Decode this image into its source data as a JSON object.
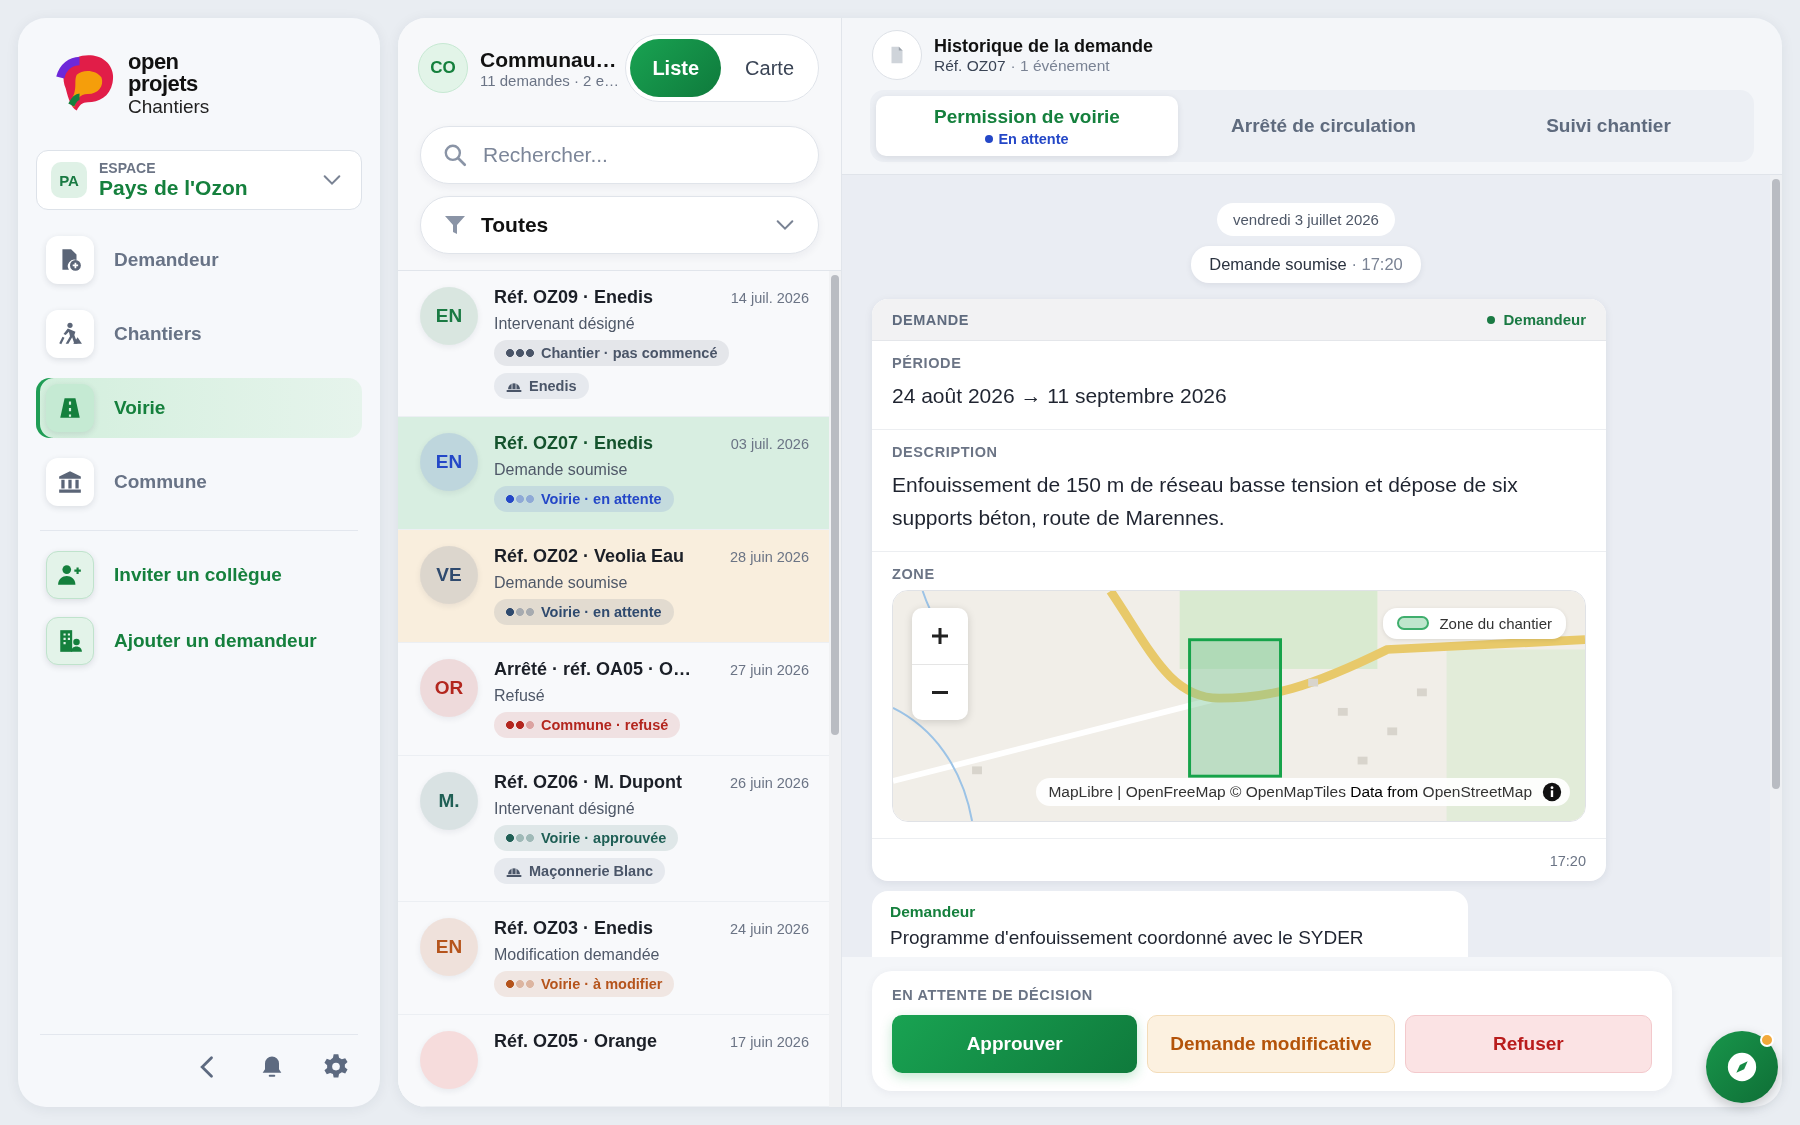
{
  "sidebar": {
    "logo": {
      "line_1": "open",
      "line_2": "projets",
      "line_3": "Chantiers"
    },
    "workspace": {
      "initials": "PA",
      "label": "ESPACE",
      "name": "Pays de l'Ozon"
    },
    "nav": [
      {
        "label": "Demandeur",
        "selected": false
      },
      {
        "label": "Chantiers",
        "selected": false
      },
      {
        "label": "Voirie",
        "selected": true
      },
      {
        "label": "Commune",
        "selected": false
      }
    ],
    "actions": [
      {
        "label": "Inviter un collègue"
      },
      {
        "label": "Ajouter un demandeur"
      }
    ]
  },
  "list_panel": {
    "avatar": "CO",
    "title": "Communau…",
    "subtitle": "11 demandes · 2 e…",
    "view_toggle": [
      {
        "label": "Liste",
        "selected": true
      },
      {
        "label": "Carte",
        "selected": false
      }
    ],
    "search": {
      "placeholder": "Rechercher..."
    },
    "filter": {
      "value": "Toutes"
    },
    "items": [
      {
        "initials": "EN",
        "color": "#1a7a43",
        "title": "Réf. OZ09 · Enedis",
        "date": "14 juil. 2026",
        "status": "Intervenant désigné",
        "selected": false,
        "hovered": false,
        "tags": [
          {
            "kind": "status",
            "label": "Chantier · pas commencé",
            "color": "#4a5568",
            "level": 1
          },
          {
            "kind": "company",
            "label": "Enedis"
          }
        ]
      },
      {
        "initials": "EN",
        "color": "#2447c7",
        "title": "Réf. OZ07 · Enedis",
        "date": "03 juil. 2026",
        "status": "Demande soumise",
        "selected": true,
        "hovered": false,
        "tags": [
          {
            "kind": "status",
            "label": "Voirie · en attente",
            "color": "#2447c7",
            "level": 0.33
          }
        ]
      },
      {
        "initials": "VE",
        "color": "#2f4a6e",
        "title": "Réf. OZ02 · Veolia Eau",
        "date": "28 juin 2026",
        "status": "Demande soumise",
        "selected": false,
        "hovered": true,
        "tags": [
          {
            "kind": "status",
            "label": "Voirie · en attente",
            "color": "#2f4a6e",
            "level": 0.33
          }
        ]
      },
      {
        "initials": "OR",
        "color": "#b3261e",
        "title": "Arrêté · réf. OA05 · O…",
        "date": "27 juin 2026",
        "status": "Refusé",
        "selected": false,
        "hovered": false,
        "tags": [
          {
            "kind": "status",
            "label": "Commune · refusé",
            "color": "#b3261e",
            "level": 0.67
          }
        ]
      },
      {
        "initials": "M.",
        "color": "#1f5f55",
        "title": "Réf. OZ06 · M. Dupont",
        "date": "26 juin 2026",
        "status": "Intervenant désigné",
        "selected": false,
        "hovered": false,
        "tags": [
          {
            "kind": "status",
            "label": "Voirie · approuvée",
            "color": "#1f5f55",
            "level": 0.33
          },
          {
            "kind": "company",
            "label": "Maçonnerie Blanc"
          }
        ]
      },
      {
        "initials": "EN",
        "color": "#b5541c",
        "title": "Réf. OZ03 · Enedis",
        "date": "24 juin 2026",
        "status": "Modification demandée",
        "selected": false,
        "hovered": false,
        "tags": [
          {
            "kind": "status",
            "label": "Voirie · à modifier",
            "color": "#b5541c",
            "level": 0.33
          }
        ]
      },
      {
        "title": "Réf. OZ05 · Orange",
        "date": "17 juin 2026",
        "selected": false,
        "hovered": false
      }
    ]
  },
  "detail": {
    "title": "Historique de la demande",
    "ref": "Réf. OZ07",
    "events": "· 1 événement",
    "tabs": [
      {
        "label": "Permission de voirie",
        "status": "En attente",
        "selected": true
      },
      {
        "label": "Arrêté de circulation",
        "selected": false
      },
      {
        "label": "Suivi chantier",
        "selected": false
      }
    ],
    "date_chip": "vendredi 3 juillet 2026",
    "event_chip": {
      "label": "Demande soumise",
      "time": "· 17:20"
    },
    "card": {
      "heading": "DEMANDE",
      "author": "Demandeur",
      "fields": [
        {
          "kind": "text",
          "label": "PÉRIODE",
          "value": "24 août 2026 → 11 septembre 2026"
        },
        {
          "kind": "text",
          "label": "DESCRIPTION",
          "value": "Enfouissement de 150 m de réseau basse tension et dépose de six supports béton, route de Marennes."
        },
        {
          "kind": "map",
          "label": "ZONE",
          "legend": "Zone du chantier",
          "attribution": "MapLibre | OpenFreeMap © OpenMapTiles **Data from** OpenStreetMap"
        }
      ],
      "time": "17:20"
    },
    "message": {
      "author": "Demandeur",
      "text": "Programme d'enfouissement coordonné avec le SYDER"
    },
    "decision": {
      "label": "EN ATTENTE DE DÉCISION",
      "buttons": [
        {
          "label": "Approuver",
          "kind": "approve"
        },
        {
          "label": "Demande modificative",
          "kind": "modify"
        },
        {
          "label": "Refuser",
          "kind": "refuse"
        }
      ]
    }
  },
  "fab": {
    "notification": true
  }
}
